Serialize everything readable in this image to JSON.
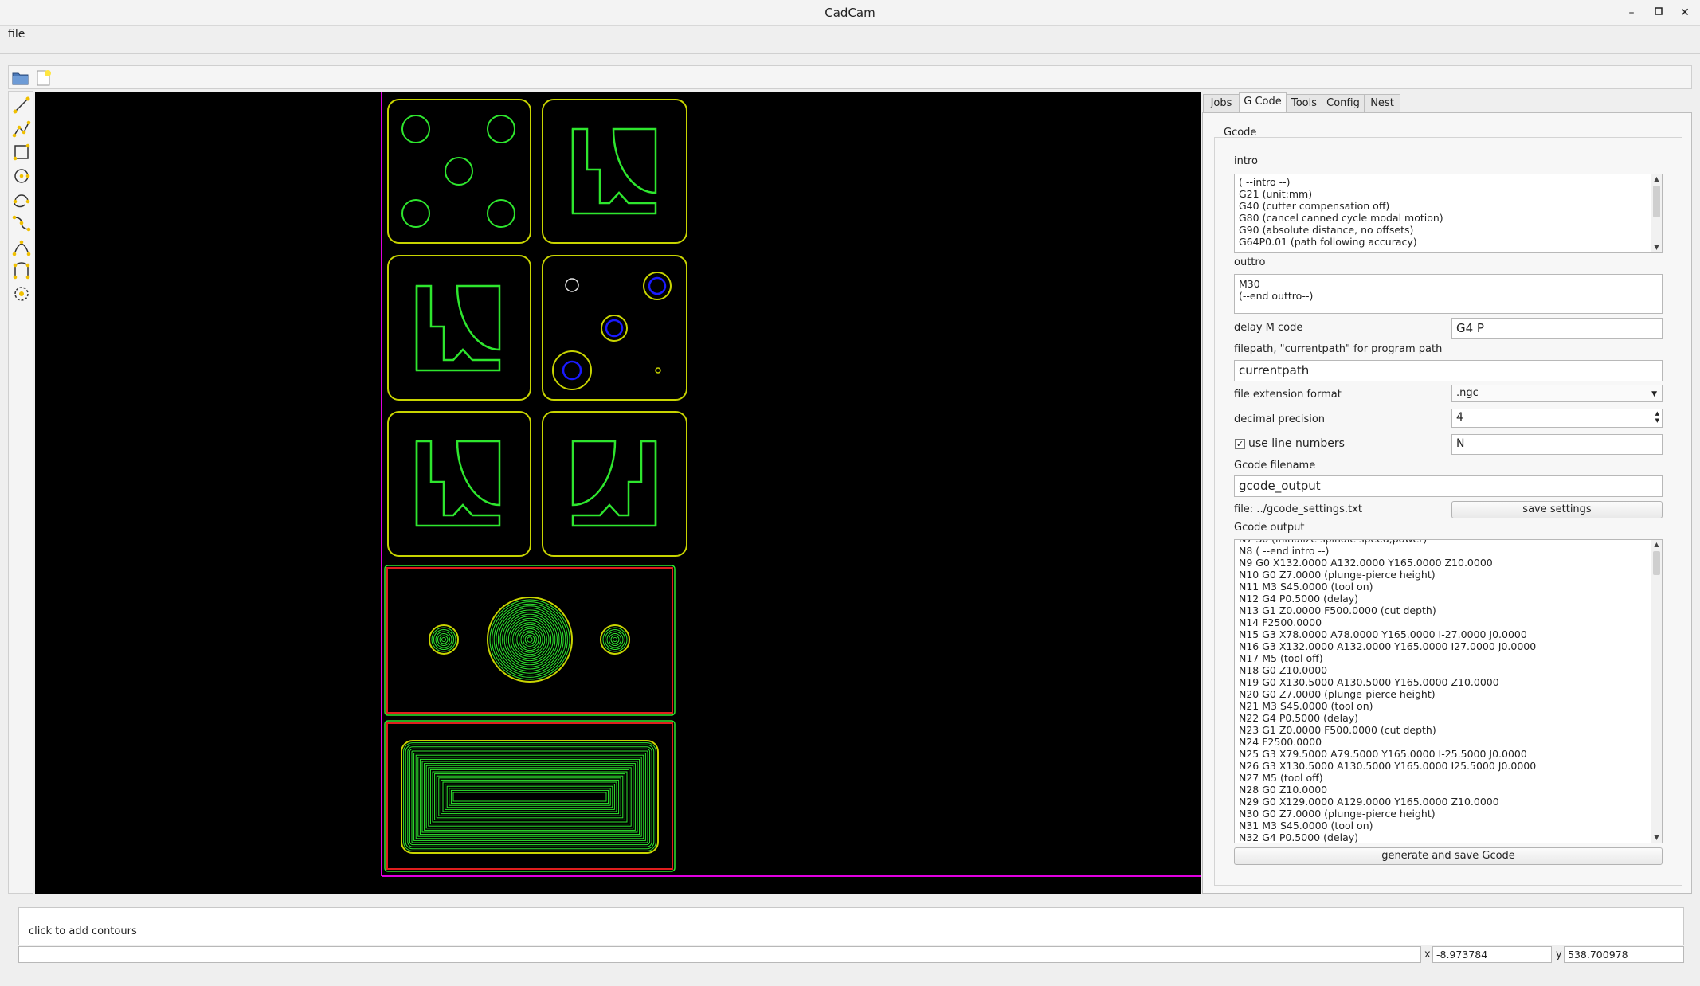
{
  "window": {
    "title": "CadCam",
    "controls": {
      "minimize": "–",
      "maximize": "▫",
      "close": "✕"
    }
  },
  "menu": {
    "file": "file"
  },
  "toolbar_icons": [
    "open-folder-icon",
    "new-file-icon"
  ],
  "left_tools": [
    "line-tool",
    "polyline-tool",
    "rectangle-tool",
    "circle-tool",
    "arc-tool",
    "spline-tool",
    "bezier-tool",
    "curve-tool",
    "gear-tool"
  ],
  "tabs": [
    "Jobs",
    "G Code",
    "Tools",
    "Config",
    "Nest"
  ],
  "active_tab": "G Code",
  "gcode": {
    "group_title": "Gcode",
    "intro_label": "intro",
    "intro_lines": [
      "( --intro --)",
      "G21 (unit:mm)",
      "G40 (cutter compensation off)",
      "G80 (cancel canned cycle modal motion)",
      "G90  (absolute distance, no offsets)",
      "G64P0.01 (path following accuracy)"
    ],
    "outtro_label": "outtro",
    "outtro_lines": [
      "M30",
      "(--end outtro--)"
    ],
    "delay_label": "delay M code",
    "delay_value": "G4 P",
    "filepath_label": "filepath, \"currentpath\" for program path",
    "filepath_value": "currentpath",
    "extension_label": "file extension format",
    "extension_value": ".ngc",
    "precision_label": "decimal precision",
    "precision_value": "4",
    "line_numbers_label": "use line numbers",
    "line_numbers_checked": true,
    "line_numbers_prefix": "N",
    "filename_label": "Gcode filename",
    "filename_value": "gcode_output",
    "settings_file": "file: ../gcode_settings.txt",
    "save_settings": "save settings",
    "output_label": "Gcode output",
    "output_lines": [
      "N8  ( --end intro --)",
      "N9 G0 X132.0000 A132.0000 Y165.0000 Z10.0000",
      "N10 G0 Z7.0000 (plunge-pierce height)",
      "N11 M3 S45.0000 (tool on)",
      "N12 G4 P0.5000 (delay)",
      "N13 G1 Z0.0000 F500.0000 (cut depth)",
      "N14 F2500.0000",
      "N15 G3 X78.0000 A78.0000 Y165.0000 I-27.0000 J0.0000",
      "N16 G3 X132.0000 A132.0000 Y165.0000 I27.0000 J0.0000",
      "N17 M5 (tool off)",
      "N18 G0 Z10.0000",
      "N19 G0 X130.5000 A130.5000 Y165.0000 Z10.0000",
      "N20 G0 Z7.0000 (plunge-pierce height)",
      "N21 M3 S45.0000 (tool on)",
      "N22 G4 P0.5000 (delay)",
      "N23 G1 Z0.0000 F500.0000 (cut depth)",
      "N24 F2500.0000",
      "N25 G3 X79.5000 A79.5000 Y165.0000 I-25.5000 J0.0000",
      "N26 G3 X130.5000 A130.5000 Y165.0000 I25.5000 J0.0000",
      "N27 M5 (tool off)",
      "N28 G0 Z10.0000",
      "N29 G0 X129.0000 A129.0000 Y165.0000 Z10.0000",
      "N30 G0 Z7.0000 (plunge-pierce height)",
      "N31 M3 S45.0000 (tool on)",
      "N32 G4 P0.5000 (delay)"
    ],
    "generate_button": "generate and save Gcode"
  },
  "status": {
    "message": "click to add contours",
    "x_label": "x",
    "x_value": "-8.973784",
    "y_label": "y",
    "y_value": "538.700978"
  },
  "colors": {
    "canvas_bg": "#000000",
    "part_outline": "#c8d400",
    "contour_green": "#2ee62e",
    "hole_blue": "#1a1aff",
    "stock_red": "#e01e1e",
    "sheet_magenta": "#e000e0"
  }
}
